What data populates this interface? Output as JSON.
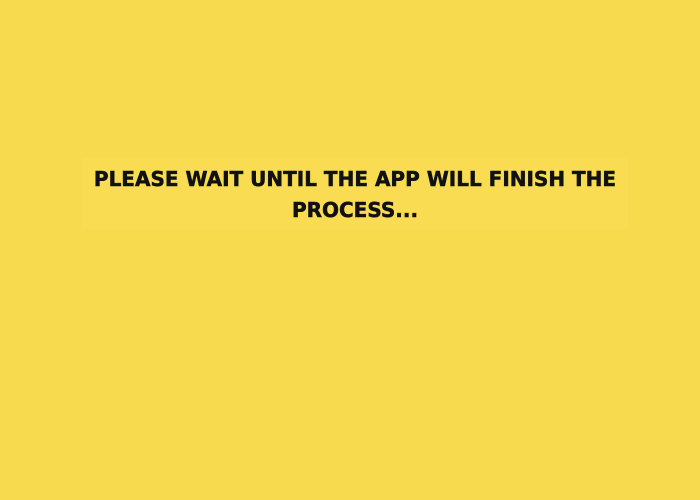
{
  "app": {
    "background_color": "#f8da4e",
    "text_color": "#111111"
  },
  "loading": {
    "message": "PLEASE WAIT UNTIL THE APP WILL FINISH THE PROCESS..."
  }
}
